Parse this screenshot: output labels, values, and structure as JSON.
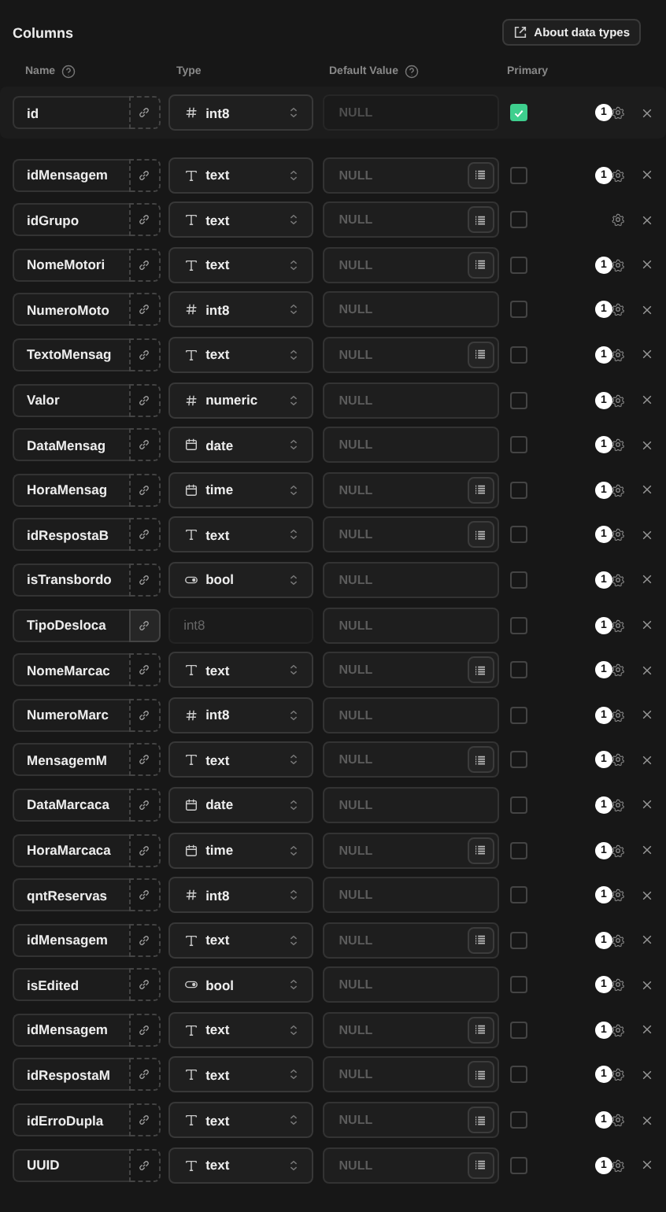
{
  "title": "Columns",
  "about_button": "About data types",
  "headers": {
    "name": "Name",
    "type": "Type",
    "default": "Default Value",
    "primary": "Primary"
  },
  "rows": [
    {
      "name": "id",
      "type": {
        "kind": "number",
        "label": "int8",
        "disabled": false
      },
      "linked": false,
      "placeholder": "NULL",
      "list": false,
      "primary": true,
      "badge": "1"
    },
    {
      "name": "idMensagem",
      "type": {
        "kind": "text",
        "label": "text",
        "disabled": false
      },
      "linked": false,
      "placeholder": "NULL",
      "list": true,
      "primary": false,
      "badge": "1"
    },
    {
      "name": "idGrupo",
      "type": {
        "kind": "text",
        "label": "text",
        "disabled": false
      },
      "linked": false,
      "placeholder": "NULL",
      "list": true,
      "primary": false
    },
    {
      "name": "NomeMotori",
      "type": {
        "kind": "text",
        "label": "text",
        "disabled": false
      },
      "linked": false,
      "placeholder": "NULL",
      "list": true,
      "primary": false,
      "badge": "1"
    },
    {
      "name": "NumeroMoto",
      "type": {
        "kind": "number",
        "label": "int8",
        "disabled": false
      },
      "linked": false,
      "placeholder": "NULL",
      "list": false,
      "primary": false,
      "badge": "1"
    },
    {
      "name": "TextoMensag",
      "type": {
        "kind": "text",
        "label": "text",
        "disabled": false
      },
      "linked": false,
      "placeholder": "NULL",
      "list": true,
      "primary": false,
      "badge": "1"
    },
    {
      "name": "Valor",
      "type": {
        "kind": "number",
        "label": "numeric",
        "disabled": false
      },
      "linked": false,
      "placeholder": "NULL",
      "list": false,
      "primary": false,
      "badge": "1"
    },
    {
      "name": "DataMensag",
      "type": {
        "kind": "calendar",
        "label": "date",
        "disabled": false
      },
      "linked": false,
      "placeholder": "NULL",
      "list": false,
      "primary": false,
      "badge": "1"
    },
    {
      "name": "HoraMensag",
      "type": {
        "kind": "calendar",
        "label": "time",
        "disabled": false
      },
      "linked": false,
      "placeholder": "NULL",
      "list": true,
      "primary": false,
      "badge": "1"
    },
    {
      "name": "idRespostaB",
      "type": {
        "kind": "text",
        "label": "text",
        "disabled": false
      },
      "linked": false,
      "placeholder": "NULL",
      "list": true,
      "primary": false,
      "badge": "1"
    },
    {
      "name": "isTransbordo",
      "type": {
        "kind": "toggle",
        "label": "bool",
        "disabled": false
      },
      "linked": false,
      "placeholder": "NULL",
      "list": false,
      "primary": false,
      "badge": "1"
    },
    {
      "name": "TipoDesloca",
      "type": {
        "kind": "none",
        "label": "int8",
        "disabled": true
      },
      "linked": true,
      "placeholder": "NULL",
      "list": false,
      "primary": false,
      "badge": "1"
    },
    {
      "name": "NomeMarcac",
      "type": {
        "kind": "text",
        "label": "text",
        "disabled": false
      },
      "linked": false,
      "placeholder": "NULL",
      "list": true,
      "primary": false,
      "badge": "1"
    },
    {
      "name": "NumeroMarc",
      "type": {
        "kind": "number",
        "label": "int8",
        "disabled": false
      },
      "linked": false,
      "placeholder": "NULL",
      "list": false,
      "primary": false,
      "badge": "1"
    },
    {
      "name": "MensagemM",
      "type": {
        "kind": "text",
        "label": "text",
        "disabled": false
      },
      "linked": false,
      "placeholder": "NULL",
      "list": true,
      "primary": false,
      "badge": "1"
    },
    {
      "name": "DataMarcaca",
      "type": {
        "kind": "calendar",
        "label": "date",
        "disabled": false
      },
      "linked": false,
      "placeholder": "NULL",
      "list": false,
      "primary": false,
      "badge": "1"
    },
    {
      "name": "HoraMarcaca",
      "type": {
        "kind": "calendar",
        "label": "time",
        "disabled": false
      },
      "linked": false,
      "placeholder": "NULL",
      "list": true,
      "primary": false,
      "badge": "1"
    },
    {
      "name": "qntReservas",
      "type": {
        "kind": "number",
        "label": "int8",
        "disabled": false
      },
      "linked": false,
      "placeholder": "NULL",
      "list": false,
      "primary": false,
      "badge": "1"
    },
    {
      "name": "idMensagem",
      "type": {
        "kind": "text",
        "label": "text",
        "disabled": false
      },
      "linked": false,
      "placeholder": "NULL",
      "list": true,
      "primary": false,
      "badge": "1"
    },
    {
      "name": "isEdited",
      "type": {
        "kind": "toggle",
        "label": "bool",
        "disabled": false
      },
      "linked": false,
      "placeholder": "NULL",
      "list": false,
      "primary": false,
      "badge": "1"
    },
    {
      "name": "idMensagem",
      "type": {
        "kind": "text",
        "label": "text",
        "disabled": false
      },
      "linked": false,
      "placeholder": "NULL",
      "list": true,
      "primary": false,
      "badge": "1"
    },
    {
      "name": "idRespostaM",
      "type": {
        "kind": "text",
        "label": "text",
        "disabled": false
      },
      "linked": false,
      "placeholder": "NULL",
      "list": true,
      "primary": false,
      "badge": "1"
    },
    {
      "name": "idErroDupla",
      "type": {
        "kind": "text",
        "label": "text",
        "disabled": false
      },
      "linked": false,
      "placeholder": "NULL",
      "list": true,
      "primary": false,
      "badge": "1"
    },
    {
      "name": "UUID",
      "type": {
        "kind": "text",
        "label": "text",
        "disabled": false
      },
      "linked": false,
      "placeholder": "NULL",
      "list": true,
      "primary": false,
      "badge": "1"
    }
  ]
}
